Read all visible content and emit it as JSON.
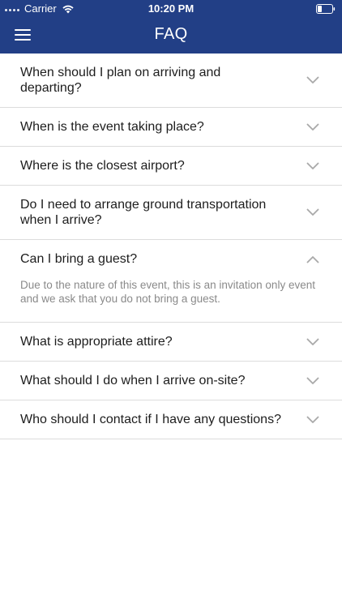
{
  "status_bar": {
    "carrier": "Carrier",
    "time": "10:20 PM"
  },
  "nav": {
    "title": "FAQ",
    "menu_icon": "hamburger-menu-icon"
  },
  "colors": {
    "header_bg": "#223f86",
    "divider": "#dcdcdc",
    "chevron": "#a9a9a9",
    "answer_text": "#8a8a8a"
  },
  "faq": [
    {
      "question": "When should I plan on arriving and departing?",
      "expanded": false
    },
    {
      "question": "When is the event taking place?",
      "expanded": false
    },
    {
      "question": "Where is the closest airport?",
      "expanded": false
    },
    {
      "question": "Do I need to arrange ground transportation when I arrive?",
      "expanded": false
    },
    {
      "question": "Can I bring a guest?",
      "expanded": true,
      "answer": "Due to the nature of this event, this is an invitation only event and we ask that you do not bring a guest."
    },
    {
      "question": "What is appropriate attire?",
      "expanded": false
    },
    {
      "question": "What should I do when I arrive on-site?",
      "expanded": false
    },
    {
      "question": "Who should I contact if I have any questions?",
      "expanded": false
    }
  ]
}
